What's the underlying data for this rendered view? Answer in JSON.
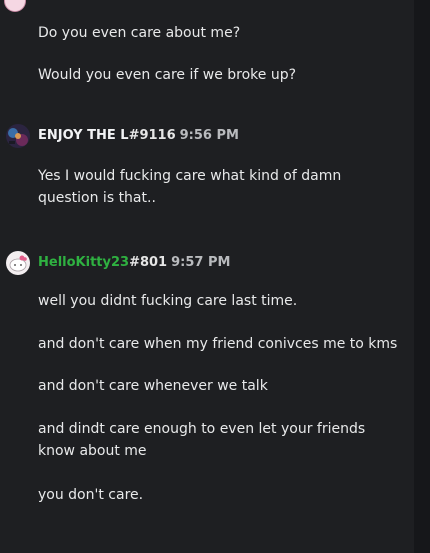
{
  "messages_top": [
    "Do you even care about me?",
    "Would you even care if we broke up?"
  ],
  "post1": {
    "username": "ENJOY THE L",
    "tag": "#9116",
    "time": "9:56 PM",
    "lines": [
      "Yes I would fucking care what kind of damn question is that.."
    ]
  },
  "post2": {
    "username": "HelloKitty23",
    "tag": "#801",
    "time": "9:57 PM",
    "lines": [
      "well you didnt fucking care last time.",
      "and don't care when my friend conivces me to kms",
      "and don't care whenever we talk",
      "and dindt care enough to even let your friends know about me",
      "you don't care."
    ]
  },
  "colors": {
    "background": "#1e1f22",
    "green_name": "#2fb141"
  }
}
